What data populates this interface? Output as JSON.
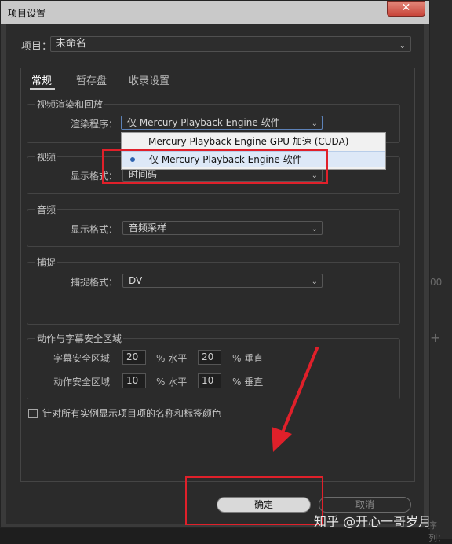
{
  "dialog": {
    "title": "项目设置",
    "close_glyph": "✕"
  },
  "project": {
    "label": "项目：",
    "value": "未命名"
  },
  "tabs": [
    {
      "label": "常规",
      "active": true
    },
    {
      "label": "暂存盘",
      "active": false
    },
    {
      "label": "收录设置",
      "active": false
    }
  ],
  "render": {
    "group_title": "视频渲染和回放",
    "renderer_label": "渲染程序：",
    "renderer_value": "仅 Mercury Playback Engine 软件",
    "options": [
      {
        "label": "Mercury Playback Engine GPU 加速 (CUDA)",
        "selected": false
      },
      {
        "label": "仅 Mercury Playback Engine 软件",
        "selected": true
      }
    ]
  },
  "video": {
    "group_title": "视频",
    "format_label": "显示格式：",
    "format_value": "时间码"
  },
  "audio": {
    "group_title": "音频",
    "format_label": "显示格式：",
    "format_value": "音频采样"
  },
  "capture": {
    "group_title": "捕捉",
    "format_label": "捕捉格式：",
    "format_value": "DV"
  },
  "safe_margins": {
    "group_title": "动作与字幕安全区域",
    "title_safe_label": "字幕安全区域",
    "title_safe_h": "20",
    "title_safe_v": "20",
    "action_safe_label": "动作安全区域",
    "action_safe_h": "10",
    "action_safe_v": "10",
    "unit_h": "% 水平",
    "unit_v": "% 垂直"
  },
  "checkbox": {
    "label": "针对所有实例显示项目项的名称和标签颜色",
    "checked": false
  },
  "buttons": {
    "ok": "确定",
    "cancel": "取消"
  },
  "background": {
    "right_glyph_1": "00",
    "right_glyph_2": "+",
    "bottom_text": "序列："
  },
  "watermark": "知乎 @开心一哥岁月",
  "colors": {
    "annotation_red": "#e0202a",
    "close_red": "#c8453a",
    "focus_blue": "#5d82b8"
  }
}
